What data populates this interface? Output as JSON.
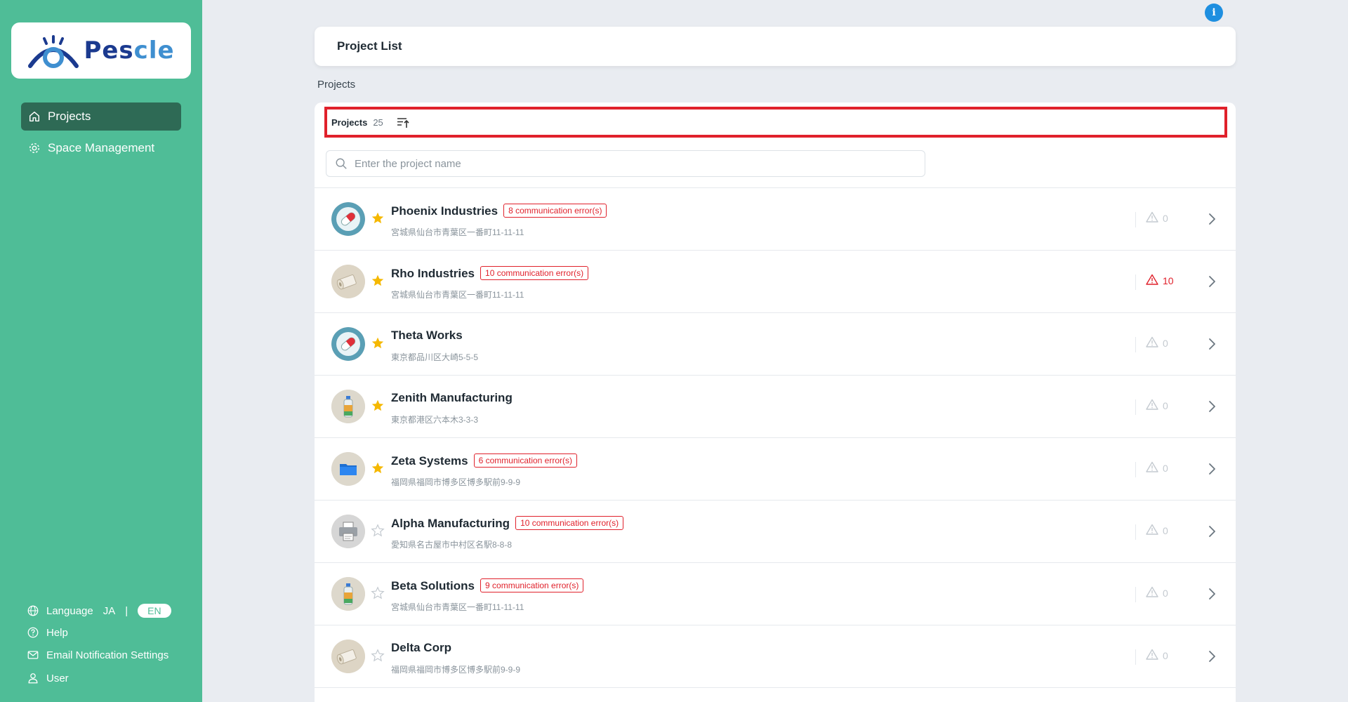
{
  "app": {
    "logo_prefix": "Pes",
    "logo_suffix": "cle"
  },
  "sidebar": {
    "nav": [
      {
        "label": "Projects",
        "icon": "home-icon",
        "active": true
      },
      {
        "label": "Space Management",
        "icon": "gear-icon",
        "active": false
      }
    ],
    "footer": {
      "language_label": "Language",
      "lang_ja": "JA",
      "lang_sep": "|",
      "lang_en": "EN",
      "help": "Help",
      "email_settings": "Email Notification Settings",
      "user": "User"
    }
  },
  "info_button": "i",
  "header": {
    "title": "Project List"
  },
  "breadcrumb": "Projects",
  "list": {
    "title": "Projects",
    "count": "25",
    "search_placeholder": "Enter the project name",
    "projects": [
      {
        "name": "Phoenix Industries",
        "error_badge": "8 communication error(s)",
        "address": "宮城県仙台市青葉区一番町11-11-11",
        "alerts": "0",
        "alert_active": false,
        "favorite": true,
        "avatar": "capsule"
      },
      {
        "name": "Rho Industries",
        "error_badge": "10 communication error(s)",
        "address": "宮城県仙台市青葉区一番町11-11-11",
        "alerts": "10",
        "alert_active": true,
        "favorite": true,
        "avatar": "roll"
      },
      {
        "name": "Theta Works",
        "error_badge": "",
        "address": "東京都品川区大崎5-5-5",
        "alerts": "0",
        "alert_active": false,
        "favorite": true,
        "avatar": "capsule"
      },
      {
        "name": "Zenith Manufacturing",
        "error_badge": "",
        "address": "東京都港区六本木3-3-3",
        "alerts": "0",
        "alert_active": false,
        "favorite": true,
        "avatar": "bottle"
      },
      {
        "name": "Zeta Systems",
        "error_badge": "6 communication error(s)",
        "address": "福岡県福岡市博多区博多駅前9-9-9",
        "alerts": "0",
        "alert_active": false,
        "favorite": true,
        "avatar": "folder"
      },
      {
        "name": "Alpha Manufacturing",
        "error_badge": "10 communication error(s)",
        "address": "愛知県名古屋市中村区名駅8-8-8",
        "alerts": "0",
        "alert_active": false,
        "favorite": false,
        "avatar": "printer"
      },
      {
        "name": "Beta Solutions",
        "error_badge": "9 communication error(s)",
        "address": "宮城県仙台市青葉区一番町11-11-11",
        "alerts": "0",
        "alert_active": false,
        "favorite": false,
        "avatar": "bottle"
      },
      {
        "name": "Delta Corp",
        "error_badge": "",
        "address": "福岡県福岡市博多区博多駅前9-9-9",
        "alerts": "0",
        "alert_active": false,
        "favorite": false,
        "avatar": "roll"
      }
    ]
  },
  "colors": {
    "sidebar_bg": "#4fbd97",
    "active_nav": "#2e6a55",
    "error_red": "#e0212b",
    "star_gold": "#f5b800",
    "info_blue": "#1e8fe0"
  }
}
